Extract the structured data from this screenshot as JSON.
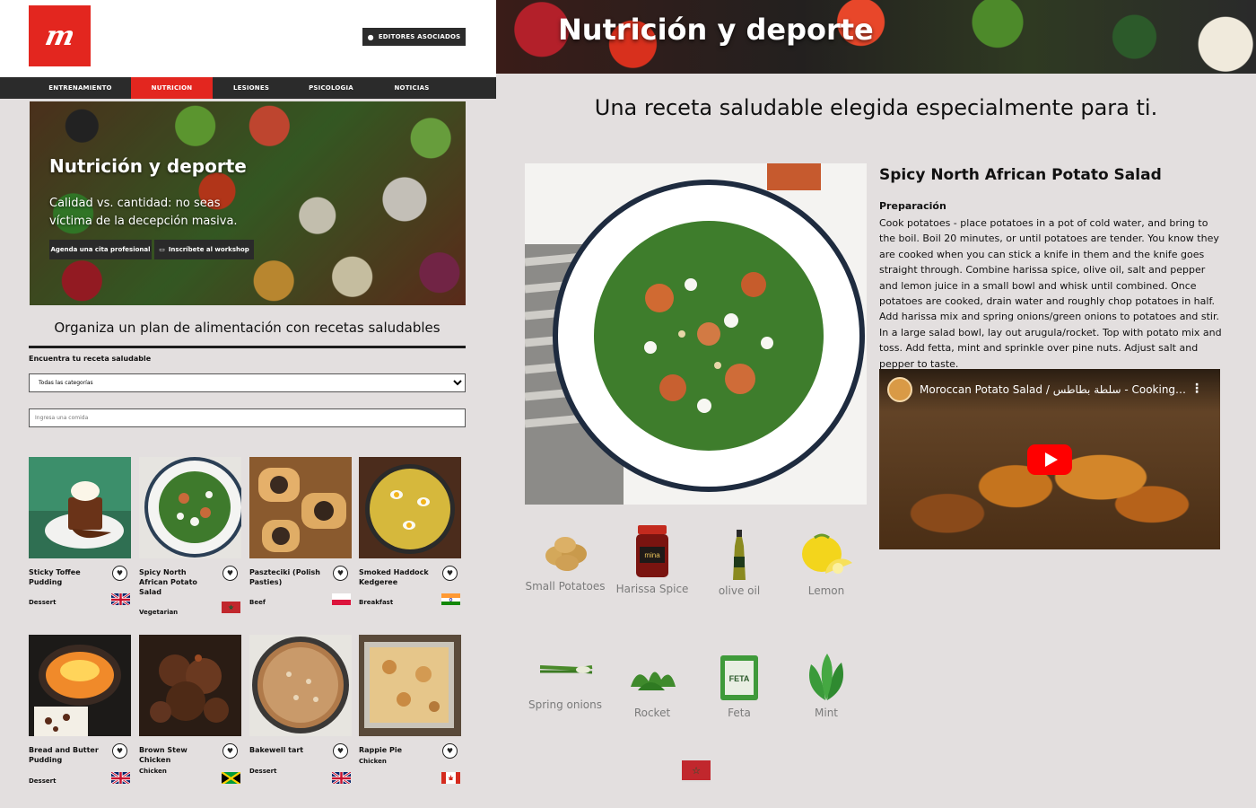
{
  "left": {
    "header": {
      "logo_text": "m",
      "editors_button": "EDITORES ASOCIADOS"
    },
    "nav": [
      {
        "label": "ENTRENAMIENTO",
        "active": false
      },
      {
        "label": "NUTRICION",
        "active": true
      },
      {
        "label": "LESIONES",
        "active": false
      },
      {
        "label": "PSICOLOGIA",
        "active": false
      },
      {
        "label": "NOTICIAS",
        "active": false
      }
    ],
    "hero": {
      "title": "Nutrición y deporte",
      "subtitle": "Calidad vs. cantidad: no seas víctima de la decepción masiva.",
      "button_appointment": "Agenda una cita profesional",
      "button_workshop": "Inscríbete al workshop"
    },
    "plan": {
      "title": "Organiza un plan de alimentación con recetas saludables",
      "find_label": "Encuentra tu receta saludable",
      "category_selected": "Todas las categorías",
      "meal_placeholder": "Ingresa una comida"
    },
    "recipes": [
      {
        "name": "Sticky Toffee Pudding",
        "category": "Dessert",
        "flag": "uk"
      },
      {
        "name": "Spicy North African Potato Salad",
        "category": "Vegetarian",
        "flag": "morocco"
      },
      {
        "name": "Paszteciki (Polish Pasties)",
        "category": "Beef",
        "flag": "poland"
      },
      {
        "name": "Smoked Haddock Kedgeree",
        "category": "Breakfast",
        "flag": "india"
      },
      {
        "name": "Bread and Butter Pudding",
        "category": "Dessert",
        "flag": "uk"
      },
      {
        "name": "Brown Stew Chicken",
        "category": "Chicken",
        "flag": "jamaica"
      },
      {
        "name": "Bakewell tart",
        "category": "Dessert",
        "flag": "uk"
      },
      {
        "name": "Rappie Pie",
        "category": "Chicken",
        "flag": "canada"
      }
    ]
  },
  "right": {
    "banner_title": "Nutrición y deporte",
    "tagline": "Una receta saludable elegida especialmente para ti.",
    "recipe": {
      "name": "Spicy North African Potato Salad",
      "prep_label": "Preparación",
      "prep_text": "Cook potatoes - place potatoes in a pot of cold water, and bring to the boil. Boil 20 minutes, or until potatoes are tender. You know they are cooked when you can stick a knife in them and the knife goes straight through. Combine harissa spice, olive oil, salt and pepper and lemon juice in a small bowl and whisk until combined. Once potatoes are cooked, drain water and roughly chop potatoes in half. Add harissa mix and spring onions/green onions to potatoes and stir. In a large salad bowl, lay out arugula/rocket. Top with potato mix and toss. Add fetta, mint and sprinkle over pine nuts. Adjust salt and pepper to taste."
    },
    "video": {
      "title": "Moroccan Potato Salad / سلطة بطاطس - CookingWit..."
    },
    "ingredients": [
      {
        "label": "Small Potatoes",
        "icon": "potatoes-icon"
      },
      {
        "label": "Harissa Spice",
        "icon": "harissa-jar-icon"
      },
      {
        "label": "olive oil",
        "icon": "olive-oil-bottle-icon"
      },
      {
        "label": "Lemon",
        "icon": "lemon-icon"
      },
      {
        "label": "Spring onions",
        "icon": "spring-onion-icon"
      },
      {
        "label": "Rocket",
        "icon": "rocket-leaves-icon"
      },
      {
        "label": "Feta",
        "icon": "feta-pack-icon"
      },
      {
        "label": "Mint",
        "icon": "mint-leaf-icon"
      }
    ],
    "country_flag": "morocco"
  },
  "colors": {
    "brand_red": "#e3261f",
    "nav_dark": "#2b2b2b",
    "panel_bg": "#e3dfdf"
  }
}
